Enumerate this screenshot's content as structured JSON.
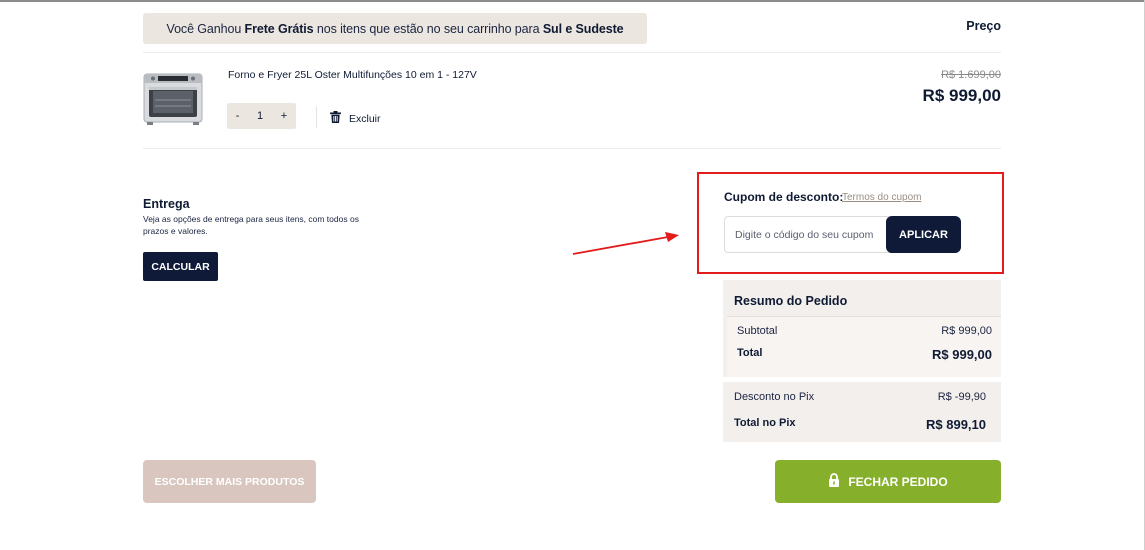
{
  "banner": {
    "prefix": "Você Ganhou ",
    "highlight": "Frete Grátis",
    "middle": " nos itens que estão no seu carrinho para ",
    "region": "Sul e Sudeste"
  },
  "cart": {
    "price_header": "Preço",
    "item": {
      "name": "Forno e Fryer 25L Oster Multifunções 10 em 1 - 127V",
      "quantity": "1",
      "minus": "-",
      "plus": "+",
      "delete_label": "Excluir",
      "old_price": "R$ 1.699,00",
      "price": "R$ 999,00"
    }
  },
  "shipping": {
    "title": "Entrega",
    "description": "Veja as opções de entrega para seus itens, com todos os prazos e valores.",
    "button": "CALCULAR"
  },
  "coupon": {
    "label": "Cupom de desconto:",
    "terms_link": "Termos do cupom",
    "placeholder": "Digite o código do seu cupom",
    "button": "APLICAR",
    "highlight_color": "#e31b1b"
  },
  "summary": {
    "title": "Resumo do Pedido",
    "subtotal_label": "Subtotal",
    "subtotal_value": "R$ 999,00",
    "total_label": "Total",
    "total_value": "R$ 999,00",
    "pix_discount_label": "Desconto no Pix",
    "pix_discount_value": "R$ -99,90",
    "pix_total_label": "Total no Pix",
    "pix_total_value": "R$ 899,10"
  },
  "actions": {
    "more_products": "ESCOLHER MAIS PRODUTOS",
    "checkout": "FECHAR PEDIDO"
  },
  "colors": {
    "navy": "#0e1a38",
    "beige": "#ece6e0",
    "green": "#86b02c",
    "rose": "#d9c6bf"
  }
}
